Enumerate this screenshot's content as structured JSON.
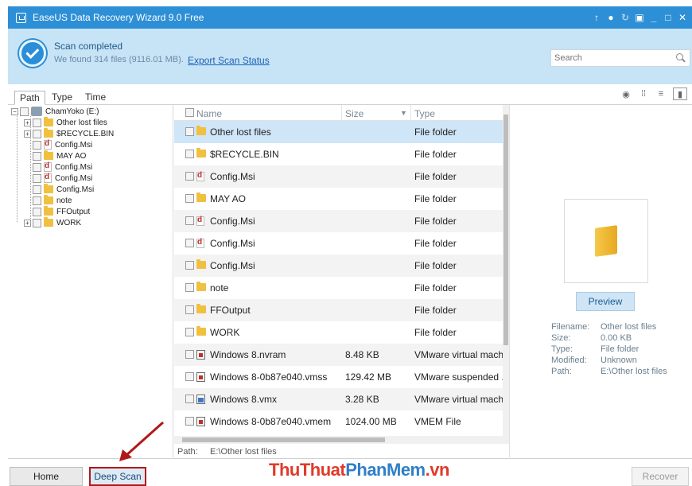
{
  "window": {
    "title": "EaseUS Data Recovery Wizard 9.0 Free",
    "controls": [
      "upload-icon",
      "chat-icon",
      "refresh-icon",
      "restore-icon",
      "minimize-icon",
      "maximize-icon",
      "close-icon"
    ]
  },
  "header": {
    "status_title": "Scan completed",
    "summary": "We found 314 files (9116.01 MB).",
    "export_link": "Export Scan Status",
    "search_placeholder": "Search"
  },
  "tabs": [
    {
      "label": "Path",
      "active": true
    },
    {
      "label": "Type",
      "active": false
    },
    {
      "label": "Time",
      "active": false
    }
  ],
  "tree": {
    "root": "ChamYoko (E:)",
    "items": [
      {
        "label": "Other lost files",
        "icon": "folder-icon"
      },
      {
        "label": "$RECYCLE.BIN",
        "icon": "folder-icon"
      },
      {
        "label": "Config.Msi",
        "icon": "document-icon"
      },
      {
        "label": "MAY AO",
        "icon": "folder-icon"
      },
      {
        "label": "Config.Msi",
        "icon": "document-icon"
      },
      {
        "label": "Config.Msi",
        "icon": "document-icon"
      },
      {
        "label": "Config.Msi",
        "icon": "folder-icon"
      },
      {
        "label": "note",
        "icon": "folder-icon"
      },
      {
        "label": "FFOutput",
        "icon": "folder-icon"
      },
      {
        "label": "WORK",
        "icon": "folder-icon"
      }
    ]
  },
  "filelist": {
    "columns": {
      "name": "Name",
      "size": "Size",
      "type": "Type"
    },
    "rows": [
      {
        "name": "Other lost files",
        "size": "",
        "type": "File folder",
        "icon": "folder-icon"
      },
      {
        "name": "$RECYCLE.BIN",
        "size": "",
        "type": "File folder",
        "icon": "folder-icon"
      },
      {
        "name": "Config.Msi",
        "size": "",
        "type": "File folder",
        "icon": "document-icon"
      },
      {
        "name": "MAY AO",
        "size": "",
        "type": "File folder",
        "icon": "folder-icon"
      },
      {
        "name": "Config.Msi",
        "size": "",
        "type": "File folder",
        "icon": "document-icon"
      },
      {
        "name": "Config.Msi",
        "size": "",
        "type": "File folder",
        "icon": "document-icon"
      },
      {
        "name": "Config.Msi",
        "size": "",
        "type": "File folder",
        "icon": "folder-icon"
      },
      {
        "name": "note",
        "size": "",
        "type": "File folder",
        "icon": "folder-icon"
      },
      {
        "name": "FFOutput",
        "size": "",
        "type": "File folder",
        "icon": "folder-icon"
      },
      {
        "name": "WORK",
        "size": "",
        "type": "File folder",
        "icon": "folder-icon"
      },
      {
        "name": "Windows 8.nvram",
        "size": "8.48 KB",
        "type": "VMware virtual mach..",
        "icon": "vm-file-icon"
      },
      {
        "name": "Windows 8-0b87e040.vmss",
        "size": "129.42 MB",
        "type": "VMware suspended ..",
        "icon": "vm-file-icon"
      },
      {
        "name": "Windows 8.vmx",
        "size": "3.28 KB",
        "type": "VMware virtual mach..",
        "icon": "vmx-file-icon"
      },
      {
        "name": "Windows 8-0b87e040.vmem",
        "size": "1024.00 MB",
        "type": "VMEM File",
        "icon": "vm-file-icon"
      }
    ]
  },
  "pathbar": {
    "label": "Path:",
    "value": "E:\\Other lost files"
  },
  "preview": {
    "button": "Preview",
    "details": [
      {
        "key": "Filename:",
        "value": "Other lost files"
      },
      {
        "key": "Size:",
        "value": "0.00 KB"
      },
      {
        "key": "Type:",
        "value": "File folder"
      },
      {
        "key": "Modified:",
        "value": "Unknown"
      },
      {
        "key": "Path:",
        "value": "E:\\Other lost files"
      }
    ]
  },
  "bottom": {
    "home": "Home",
    "deep_scan": "Deep Scan",
    "recover": "Recover",
    "watermark_a": "ThuThuat",
    "watermark_b": "PhanMem",
    "watermark_c": ".vn"
  },
  "colors": {
    "titlebar": "#2d8fd6",
    "header": "#c7e3f6",
    "selected_row": "#cfe5f8",
    "highlight_border": "#b01818"
  }
}
